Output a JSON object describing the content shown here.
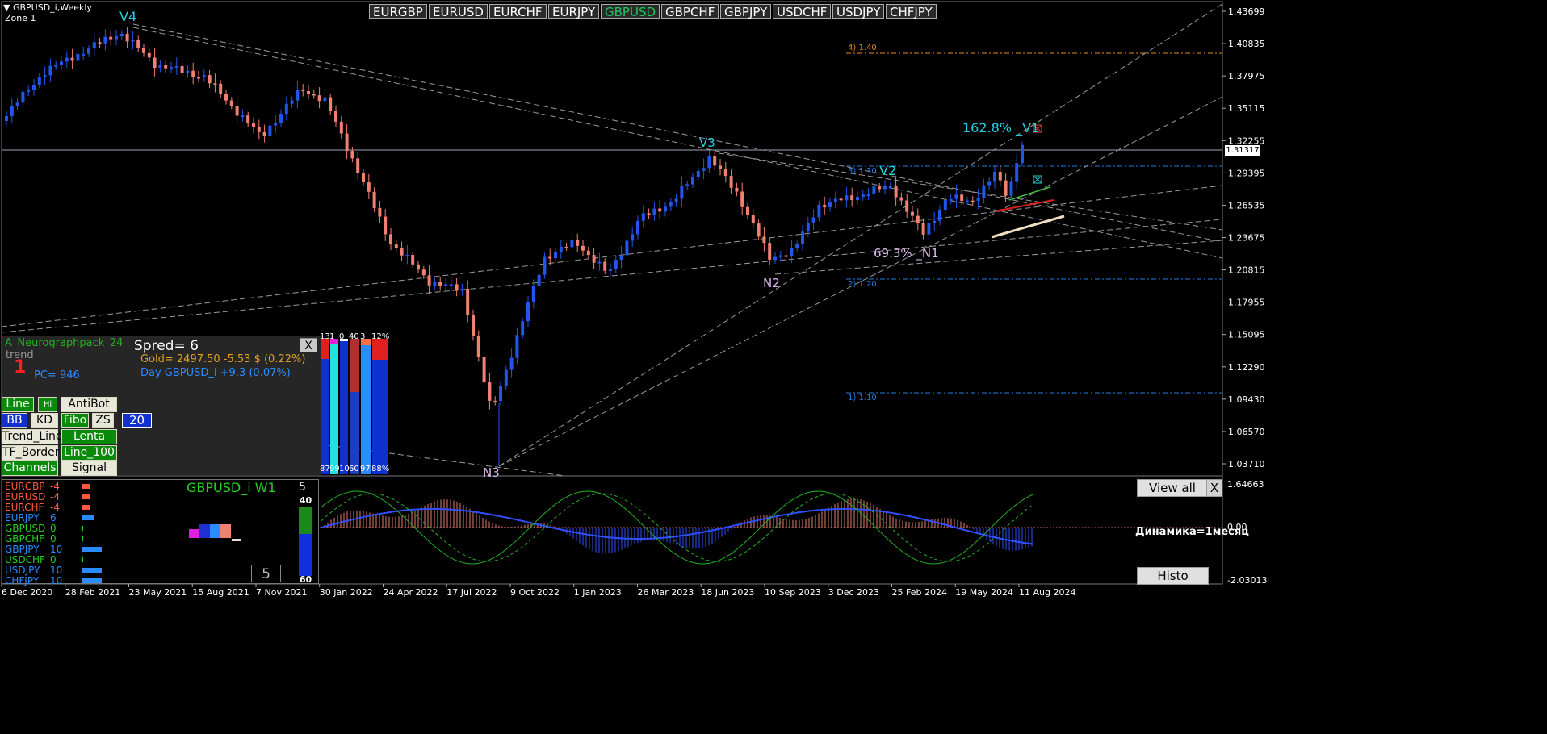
{
  "chart_header": {
    "symbol_tf": "GBPUSD_i,Weekly",
    "zone": "Zone 1"
  },
  "symbols": [
    {
      "label": "EURGBP",
      "active": false
    },
    {
      "label": "EURUSD",
      "active": false
    },
    {
      "label": "EURCHF",
      "active": false
    },
    {
      "label": "EURJPY",
      "active": false
    },
    {
      "label": "GBPUSD",
      "active": true
    },
    {
      "label": "GBPCHF",
      "active": false
    },
    {
      "label": "GBPJPY",
      "active": false
    },
    {
      "label": "USDCHF",
      "active": false
    },
    {
      "label": "USDJPY",
      "active": false
    },
    {
      "label": "CHFJPY",
      "active": false
    }
  ],
  "price_axis": [
    "1.43699",
    "1.40835",
    "1.37975",
    "1.35115",
    "1.32255",
    "1.29395",
    "1.26535",
    "1.23675",
    "1.20815",
    "1.17955",
    "1.15095",
    "1.12290",
    "1.09430",
    "1.06570",
    "1.03710"
  ],
  "current_price": "1.31317",
  "time_axis": [
    "6 Dec 2020",
    "28 Feb 2021",
    "23 May 2021",
    "15 Aug 2021",
    "7 Nov 2021",
    "30 Jan 2022",
    "24 Apr 2022",
    "17 Jul 2022",
    "9 Oct 2022",
    "1 Jan 2023",
    "26 Mar 2023",
    "18 Jun 2023",
    "10 Sep 2023",
    "3 Dec 2023",
    "25 Feb 2024",
    "19 May 2024",
    "11 Aug 2024"
  ],
  "wave_labels": {
    "v4": "V4",
    "v3": "V3",
    "v2": "V2",
    "v1": "162.8% _V1",
    "n1": "69.3% _N1",
    "n2": "N2",
    "n3": "N3"
  },
  "fibo_levels": {
    "l4": "4)  1.40",
    "l3": "3)  1.30",
    "l2": "2)  1.20",
    "l1": "1)  1.10"
  },
  "panel": {
    "title": "A_Neurographpack_24",
    "trend_label": "trend",
    "trend_value": "1",
    "pc": "PC=  946",
    "spread": "Spred= 6",
    "gold": "Gold= 2497.50 -5.53 $ (0.22%)",
    "day": "Day GBPUSD_i   +9.3 (0.07%)",
    "close": "X",
    "number_box": "20",
    "buttons": {
      "line": "Line",
      "hi": "Hi",
      "antibot": "AntiBot",
      "bb": "BB",
      "kd": "KD",
      "fibo": "Fibo",
      "zs": "ZS",
      "trend_line": "Trend_Line",
      "lenta": "Lenta",
      "tf_border": "TF_Border",
      "line_100": "Line_100",
      "channels": "Channels",
      "signal": "Signal"
    },
    "bars_top": [
      "13",
      "1",
      "0",
      "40",
      "3",
      "12%"
    ],
    "bars_bottom": [
      "87",
      "99",
      "100",
      "60",
      "97",
      "88%"
    ]
  },
  "strength": {
    "items": [
      {
        "pair": "EURGBP",
        "value": "-4",
        "color": "#ff5a3c",
        "level": -4
      },
      {
        "pair": "EURUSD",
        "value": "-4",
        "color": "#ff5a3c",
        "level": -4
      },
      {
        "pair": "EURCHF",
        "value": "-4",
        "color": "#ff5a3c",
        "level": -4
      },
      {
        "pair": "EURJPY",
        "value": "6",
        "color": "#2a8cff",
        "level": 6
      },
      {
        "pair": "GBPUSD",
        "value": "0",
        "color": "#22d022",
        "level": 0
      },
      {
        "pair": "GBPCHF",
        "value": "0",
        "color": "#22d022",
        "level": 0
      },
      {
        "pair": "GBPJPY",
        "value": "10",
        "color": "#2a8cff",
        "level": 10
      },
      {
        "pair": "USDCHF",
        "value": "0",
        "color": "#22d022",
        "level": 0
      },
      {
        "pair": "USDJPY",
        "value": "10",
        "color": "#2a8cff",
        "level": 10
      },
      {
        "pair": "CHFJPY",
        "value": "10",
        "color": "#2a8cff",
        "level": 10
      }
    ],
    "title": "GBPUSD_i  W1",
    "count": "5",
    "meter_top": "40",
    "meter_bottom": "60",
    "box_value": "5"
  },
  "oscillator": {
    "axis": [
      "1.64663",
      "0.00",
      "-2.03013"
    ],
    "label": "Динамика=1месяц",
    "view_all": "View all",
    "close": "X",
    "histo": "Histo"
  },
  "colors": {
    "bull": "#2255ee",
    "bear": "#f08070",
    "accent_green": "#22c55e"
  }
}
